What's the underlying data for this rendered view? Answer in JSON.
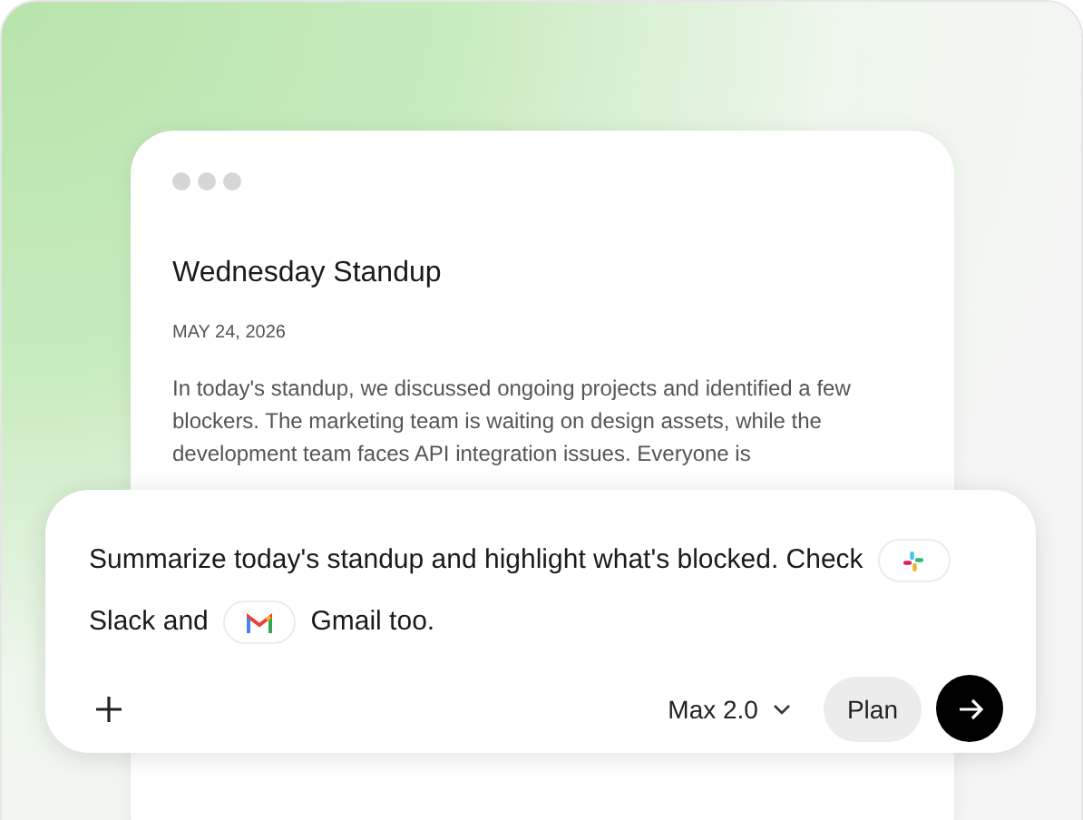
{
  "note": {
    "title": "Wednesday Standup",
    "date": "MAY 24, 2026",
    "body": "In today's standup, we discussed ongoing projects and identified a few blockers. The marketing team is waiting on design assets, while the development team faces API integration issues. Everyone is"
  },
  "prompt": {
    "segments": [
      {
        "kind": "text",
        "text": "Summarize today's standup and highlight what's blocked. Check"
      },
      {
        "kind": "slack"
      },
      {
        "kind": "text",
        "text": "Slack and"
      },
      {
        "kind": "gmail"
      },
      {
        "kind": "text",
        "text": "Gmail too."
      }
    ],
    "model": "Max 2.0",
    "mode_button": "Plan"
  }
}
